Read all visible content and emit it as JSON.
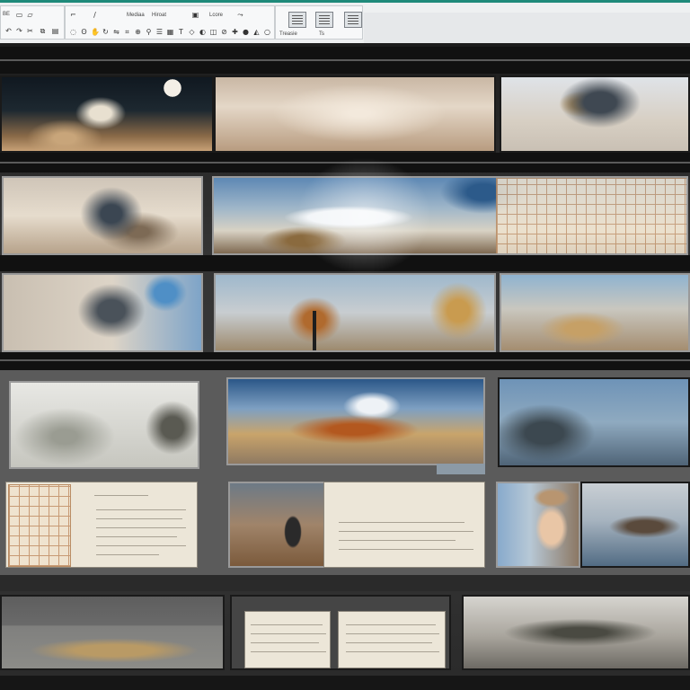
{
  "toolbar": {
    "groups": [
      {
        "labels": [
          "BE",
          "",
          ""
        ]
      },
      {
        "labels": [
          "Mediaa",
          "Hiroat",
          "Lcore"
        ]
      },
      {
        "labels": [
          "Treasie",
          "Ts",
          ""
        ]
      }
    ],
    "icon_names": [
      "search-icon",
      "pan-icon",
      "zoom-icon",
      "rotate-icon",
      "crop-icon",
      "layer-icon",
      "grid-icon",
      "settings-icon"
    ]
  },
  "colors": {
    "toolbar_bg": "#eef0f1",
    "accent": "#1f8a7a",
    "workspace_bg": "#2b2b2b",
    "doc_paper": "#ece6d8",
    "grid_line": "#c79a74"
  },
  "gallery": {
    "rows": [
      {
        "thumbs": [
          "landscape-cloud-tree",
          "hazy-sepia-sky",
          "tree-on-rock-sky"
        ]
      },
      {
        "thumbs": [
          "misty-tree-sepia",
          "snowy-mountain-panorama-with-grid"
        ]
      },
      {
        "thumbs": [
          "stormy-cloud-tree",
          "figure-under-tree",
          "sepia-horizon"
        ]
      },
      {
        "thumbs": [
          "foggy-forest",
          "mountain-valley-sunset",
          "dark-sea-clouds"
        ]
      },
      {
        "thumbs": [
          "grid-document",
          "warrior-with-document",
          "portrait-and-seascape"
        ]
      },
      {
        "thumbs": [
          "golden-fog-field",
          "two-documents",
          "misty-lake"
        ]
      }
    ]
  }
}
